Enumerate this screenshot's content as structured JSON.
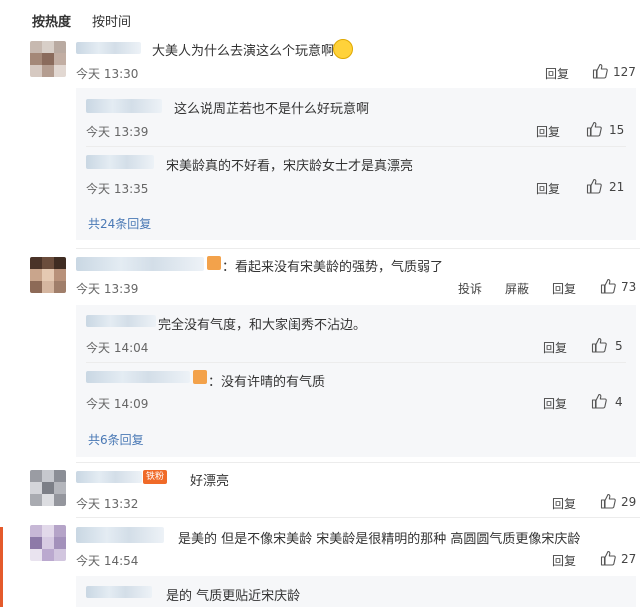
{
  "sort": {
    "hot": "按热度",
    "time": "按时间"
  },
  "comments": [
    {
      "text": "大美人为什么去演这么个玩意啊",
      "time": "今天 13:30",
      "reply": "回复",
      "likes": "127",
      "replies": [
        {
          "text": "这么说周芷若也不是什么好玩意啊",
          "time": "今天 13:39",
          "reply": "回复",
          "likes": "15"
        },
        {
          "text": "宋美龄真的不好看，宋庆龄女士才是真漂亮",
          "time": "今天 13:35",
          "reply": "回复",
          "likes": "21"
        }
      ],
      "more": "共24条回复"
    },
    {
      "text": "：看起来没有宋美龄的强势，气质弱了",
      "time": "今天 13:39",
      "report": "投诉",
      "block": "屏蔽",
      "reply": "回复",
      "likes": "73",
      "replies": [
        {
          "text": "完全没有气度，和大家闺秀不沾边。",
          "time": "今天 14:04",
          "reply": "回复",
          "likes": "5"
        },
        {
          "text": "：没有许晴的有气质",
          "time": "今天 14:09",
          "reply": "回复",
          "likes": "4"
        }
      ],
      "more": "共6条回复"
    },
    {
      "badge": "铁粉",
      "text": "好漂亮",
      "time": "今天 13:32",
      "reply": "回复",
      "likes": "29"
    },
    {
      "text": "是美的 但是不像宋美龄 宋美龄是很精明的那种 高圆圆气质更像宋庆龄",
      "time": "今天 14:54",
      "reply": "回复",
      "likes": "27",
      "replies": [
        {
          "text": "是的 气质更贴近宋庆龄"
        }
      ]
    }
  ],
  "colors": {
    "link": "#4a79b5",
    "accent": "#f06a28",
    "reply_bg": "#f6f7f9"
  }
}
